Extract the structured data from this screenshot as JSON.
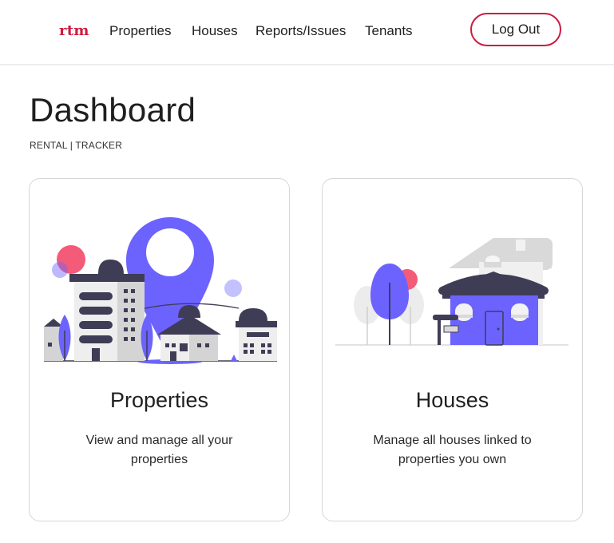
{
  "nav": {
    "logo": "rtm",
    "links": [
      "Properties",
      "Houses",
      "Reports/Issues",
      "Tenants"
    ],
    "logout_label": "Log Out"
  },
  "header": {
    "title": "Dashboard",
    "subtitle": "RENTAL | TRACKER"
  },
  "cards": [
    {
      "title": "Properties",
      "description": "View and manage all your properties",
      "illustration": "city-location-pin-illustration"
    },
    {
      "title": "Houses",
      "description": "Manage all houses linked to properties you own",
      "illustration": "house-with-trees-illustration"
    }
  ],
  "colors": {
    "brand": "#cc1b3f",
    "accent": "#6c63ff",
    "dark": "#3f3d56",
    "pink": "#f45b78",
    "light_gray": "#d9d9d9"
  }
}
